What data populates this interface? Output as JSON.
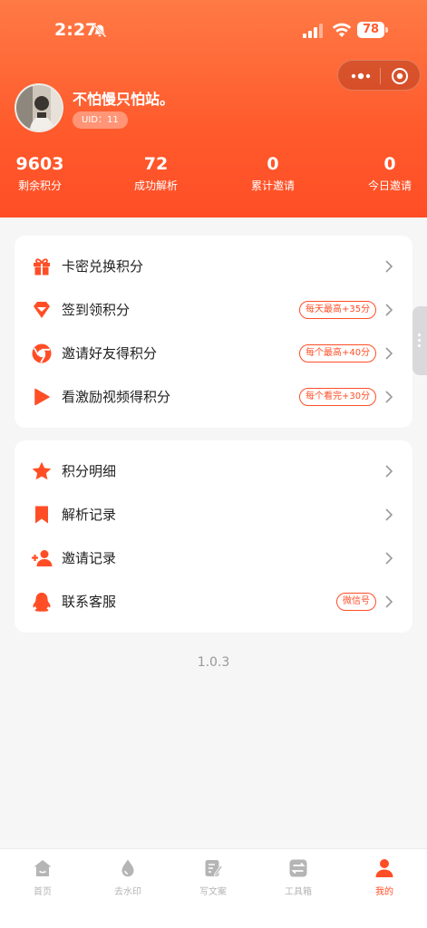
{
  "status_bar": {
    "time": "2:27",
    "battery": "78"
  },
  "profile": {
    "nickname": "不怕慢只怕站。",
    "uid": "UID：11"
  },
  "stats": [
    {
      "value": "9603",
      "label": "剩余积分"
    },
    {
      "value": "72",
      "label": "成功解析"
    },
    {
      "value": "0",
      "label": "累计邀请"
    },
    {
      "value": "0",
      "label": "今日邀请"
    }
  ],
  "points_menu": [
    {
      "label": "卡密兑换积分",
      "icon": "gift-icon",
      "tag": ""
    },
    {
      "label": "签到领积分",
      "icon": "gem-icon",
      "tag": "每天最高+35分"
    },
    {
      "label": "邀请好友得积分",
      "icon": "share-circle-icon",
      "tag": "每个最高+40分"
    },
    {
      "label": "看激励视频得积分",
      "icon": "play-icon",
      "tag": "每个看完+30分"
    }
  ],
  "records_menu": [
    {
      "label": "积分明细",
      "icon": "star-icon",
      "tag": ""
    },
    {
      "label": "解析记录",
      "icon": "bookmark-icon",
      "tag": ""
    },
    {
      "label": "邀请记录",
      "icon": "add-user-icon",
      "tag": ""
    },
    {
      "label": "联系客服",
      "icon": "penguin-icon",
      "tag": "微信号"
    }
  ],
  "version": "1.0.3",
  "tabbar": [
    {
      "label": "首页",
      "icon": "home-icon",
      "active": false
    },
    {
      "label": "去水印",
      "icon": "drop-icon",
      "active": false
    },
    {
      "label": "写文案",
      "icon": "edit-doc-icon",
      "active": false
    },
    {
      "label": "工具箱",
      "icon": "toolbox-icon",
      "active": false
    },
    {
      "label": "我的",
      "icon": "user-icon",
      "active": true
    }
  ],
  "colors": {
    "accent": "#ff4e26",
    "header_top": "#ff7a45",
    "header_bottom": "#ff4e26",
    "inactive_tab": "#b5b5b5"
  }
}
